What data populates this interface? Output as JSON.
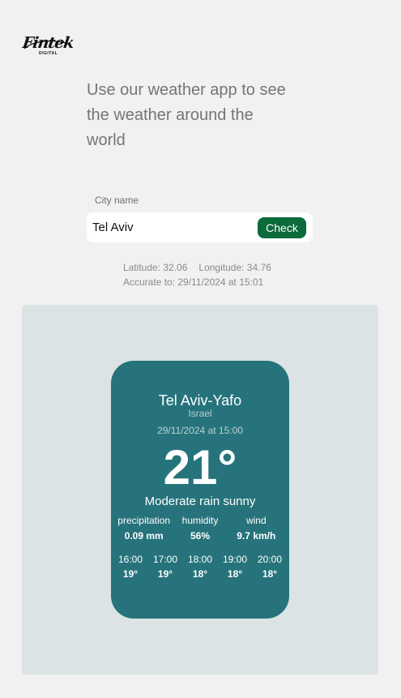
{
  "logo": {
    "wordmark": "Fintek",
    "tagline": "DIGITAL"
  },
  "headline": "Use our weather app to see the weather around the world",
  "search": {
    "label": "City name",
    "value": "Tel Aviv",
    "button_label": "Check"
  },
  "coords": {
    "latitude": "Latitude: 32.06",
    "longitude": "Longitude: 34.76",
    "accurate": "Accurate to: 29/11/2024 at 15:01"
  },
  "weather": {
    "city": "Tel Aviv-Yafo",
    "country": "Israel",
    "datetime": "29/11/2024 at 15:00",
    "temperature": "21°",
    "condition": "Moderate rain sunny",
    "stats": [
      {
        "label": "precipitation",
        "value": "0.09 mm"
      },
      {
        "label": "humidity",
        "value": "56%"
      },
      {
        "label": "wind",
        "value": "9.7 km/h"
      }
    ],
    "hourly": [
      {
        "time": "16:00",
        "temp": "19°"
      },
      {
        "time": "17:00",
        "temp": "19°"
      },
      {
        "time": "18:00",
        "temp": "18°"
      },
      {
        "time": "19:00",
        "temp": "18°"
      },
      {
        "time": "20:00",
        "temp": "18°"
      }
    ]
  },
  "colors": {
    "page_bg": "#f1f1f1",
    "panel_bg": "#dce3e5",
    "card_bg": "#26737b",
    "button_bg": "#0b6b3a"
  }
}
